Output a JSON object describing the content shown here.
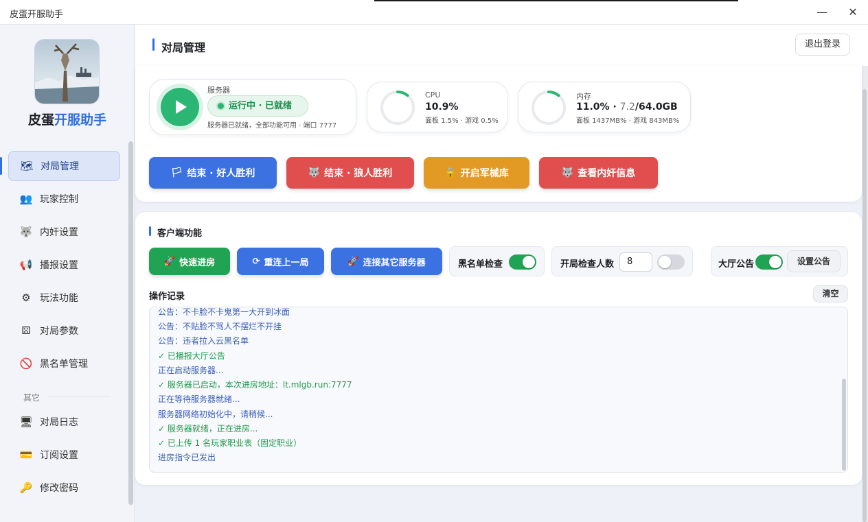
{
  "window": {
    "title": "皮蛋开服助手",
    "minimize": "—",
    "close": "✕"
  },
  "sidebar": {
    "brand_prefix": "皮蛋",
    "brand_suffix": "开服助手",
    "section_other": "其它",
    "items": [
      {
        "label": "对局管理",
        "icon": "map-icon",
        "glyph": "🗺"
      },
      {
        "label": "玩家控制",
        "icon": "users-icon",
        "glyph": "👥"
      },
      {
        "label": "内奸设置",
        "icon": "wolf-icon",
        "glyph": "🐺"
      },
      {
        "label": "播报设置",
        "icon": "megaphone-icon",
        "glyph": "📢"
      },
      {
        "label": "玩法功能",
        "icon": "gear-icon",
        "glyph": "⚙"
      },
      {
        "label": "对局参数",
        "icon": "dice-icon",
        "glyph": "⚄"
      },
      {
        "label": "黑名单管理",
        "icon": "ban-icon",
        "glyph": "🚫"
      },
      {
        "label": "对局日志",
        "icon": "monitor-icon",
        "glyph": "🖥"
      },
      {
        "label": "订阅设置",
        "icon": "card-icon",
        "glyph": "💳"
      },
      {
        "label": "修改密码",
        "icon": "key-icon",
        "glyph": "🔑"
      }
    ]
  },
  "header": {
    "title": "对局管理",
    "logout": "退出登录"
  },
  "server": {
    "label": "服务器",
    "status": "运行中 · 已就绪",
    "detail": "服务器已就绪，全部功能可用 · 端口 7777"
  },
  "cpu": {
    "label": "CPU",
    "value": "10.9%",
    "detail": "面板 1.5% · 游戏 0.5%",
    "fraction": 0.109
  },
  "memory": {
    "label": "内存",
    "value_prefix": "11.0% · ",
    "used": "7.2",
    "total": "/64.0GB",
    "detail": "面板 1437MB% · 游戏 843MB%",
    "fraction": 0.11
  },
  "actions": [
    {
      "label": "结束 · 好人胜利",
      "glyph": "🏳"
    },
    {
      "label": "结束 · 狼人胜利",
      "glyph": "🐺"
    },
    {
      "label": "开启军械库",
      "glyph": "🔒"
    },
    {
      "label": "查看内奸信息",
      "glyph": "🐺"
    }
  ],
  "client": {
    "title": "客户端功能",
    "quick_join": "快速进房",
    "reconnect": "重连上一局",
    "connect_other": "连接其它服务器",
    "blacklist_check": "黑名单检查",
    "blacklist_on": true,
    "start_check_label": "开局检查人数",
    "start_check_value": "8",
    "start_check_on": false,
    "lobby_notice": "大厅公告",
    "lobby_on": true,
    "set_notice": "设置公告"
  },
  "log": {
    "label": "操作记录",
    "clear": "清空",
    "lines": [
      {
        "text": "公告：不卡脸不卡鬼第一大开到冰面",
        "type": "info"
      },
      {
        "text": "公告：不贴脸不骂人不摆烂不开挂",
        "type": "info"
      },
      {
        "text": "公告：违者拉入云黑名单",
        "type": "info"
      },
      {
        "text": "✓ 已播报大厅公告",
        "type": "ok"
      },
      {
        "text": "正在启动服务器...",
        "type": "info"
      },
      {
        "text": "✓ 服务器已启动，本次进房地址：lt.mlgb.run:7777",
        "type": "ok"
      },
      {
        "text": "正在等待服务器就绪...",
        "type": "info"
      },
      {
        "text": "服务器网络初始化中，请稍候...",
        "type": "info"
      },
      {
        "text": "✓ 服务器就绪，正在进房...",
        "type": "ok"
      },
      {
        "text": "✓ 已上传 1 名玩家职业表（固定职业）",
        "type": "ok"
      },
      {
        "text": "进房指令已发出",
        "type": "info"
      }
    ]
  },
  "colors": {
    "accent": "#2f6fe0",
    "green": "#20a352",
    "red": "#e04e4e",
    "orange": "#e39a25",
    "blue": "#3b71e0"
  }
}
